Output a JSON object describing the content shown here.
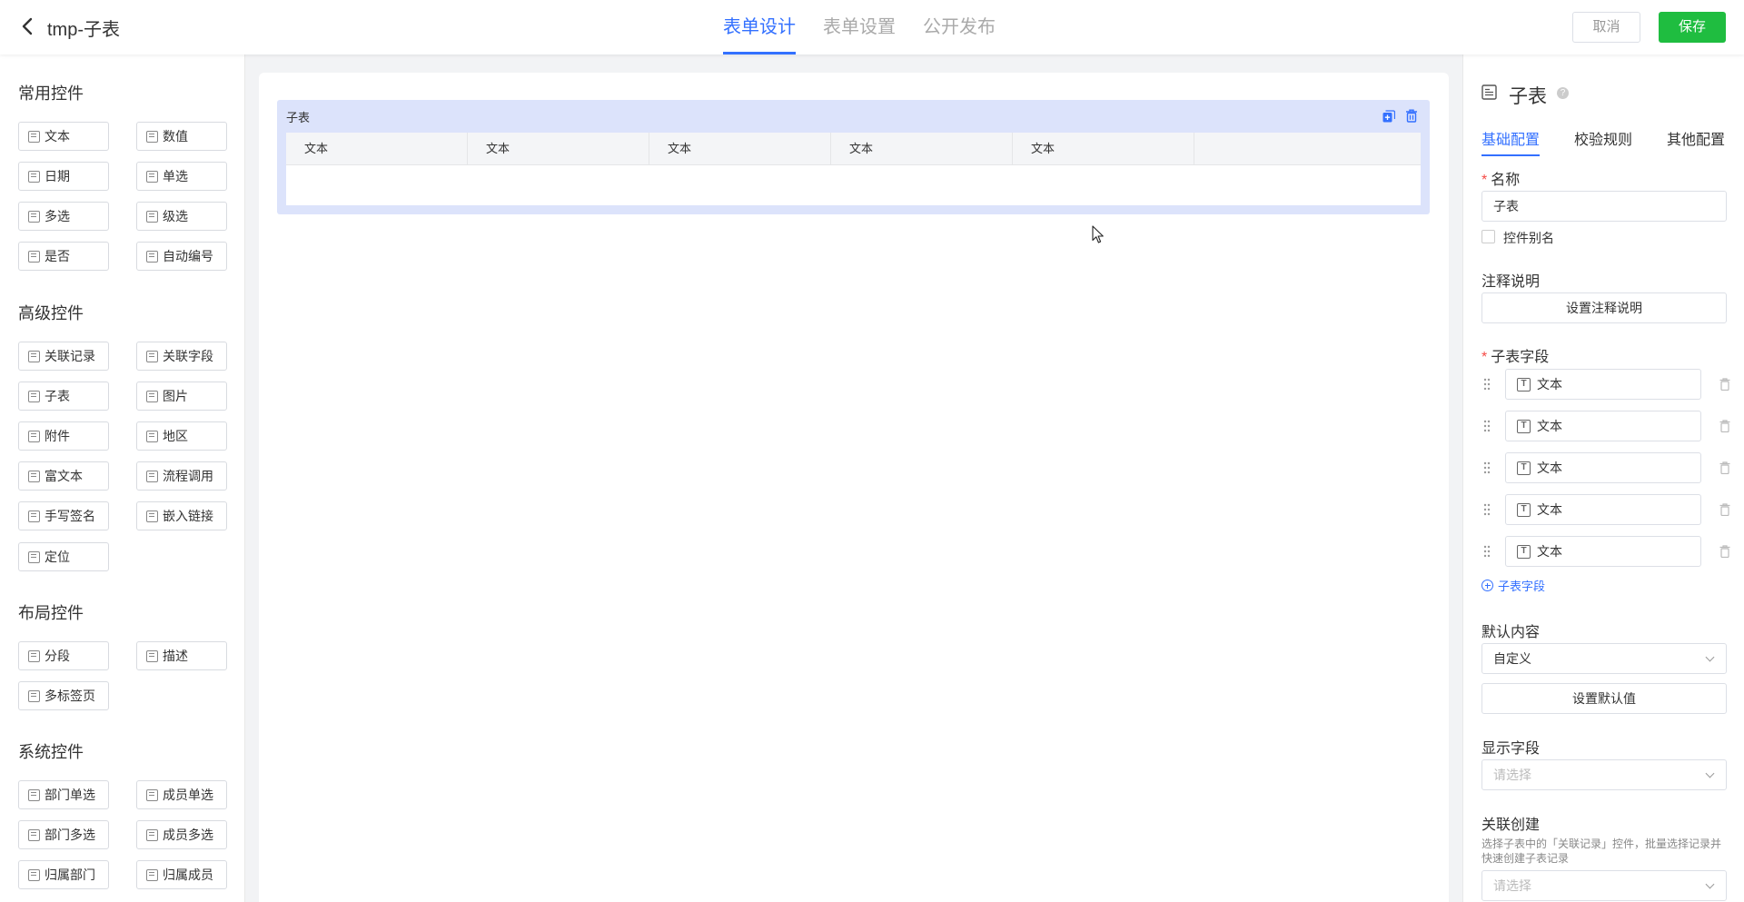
{
  "header": {
    "title": "tmp-子表",
    "tabs": [
      {
        "label": "表单设计",
        "active": true
      },
      {
        "label": "表单设置",
        "active": false
      },
      {
        "label": "公开发布",
        "active": false
      }
    ],
    "cancel_label": "取消",
    "save_label": "保存"
  },
  "palette": {
    "groups": [
      {
        "title": "常用控件",
        "items": [
          "文本",
          "数值",
          "日期",
          "单选",
          "多选",
          "级选",
          "是否",
          "自动编号"
        ]
      },
      {
        "title": "高级控件",
        "items": [
          "关联记录",
          "关联字段",
          "子表",
          "图片",
          "附件",
          "地区",
          "富文本",
          "流程调用",
          "手写签名",
          "嵌入链接",
          "定位"
        ]
      },
      {
        "title": "布局控件",
        "items": [
          "分段",
          "描述",
          "多标签页"
        ]
      },
      {
        "title": "系统控件",
        "items": [
          "部门单选",
          "成员单选",
          "部门多选",
          "成员多选",
          "归属部门",
          "归属成员"
        ]
      }
    ]
  },
  "canvas": {
    "subtable_label": "子表",
    "columns": [
      "文本",
      "文本",
      "文本",
      "文本",
      "文本"
    ]
  },
  "panel": {
    "title": "子表",
    "tabs": [
      {
        "label": "基础配置",
        "active": true
      },
      {
        "label": "校验规则",
        "active": false
      },
      {
        "label": "其他配置",
        "active": false
      }
    ],
    "name_label": "名称",
    "name_value": "子表",
    "alias_label": "控件别名",
    "note_label": "注释说明",
    "note_button": "设置注释说明",
    "fields_label": "子表字段",
    "fields": [
      "文本",
      "文本",
      "文本",
      "文本",
      "文本"
    ],
    "add_field_label": "子表字段",
    "default_label": "默认内容",
    "default_value": "自定义",
    "default_button": "设置默认值",
    "display_label": "显示字段",
    "display_placeholder": "请选择",
    "link_label": "关联创建",
    "link_hint": "选择子表中的「关联记录」控件，批量选择记录并快速创建子表记录",
    "link_placeholder": "请选择"
  },
  "colors": {
    "accent": "#3370ff",
    "save": "#1fbd40",
    "subtable_bg": "#dce3fb"
  }
}
